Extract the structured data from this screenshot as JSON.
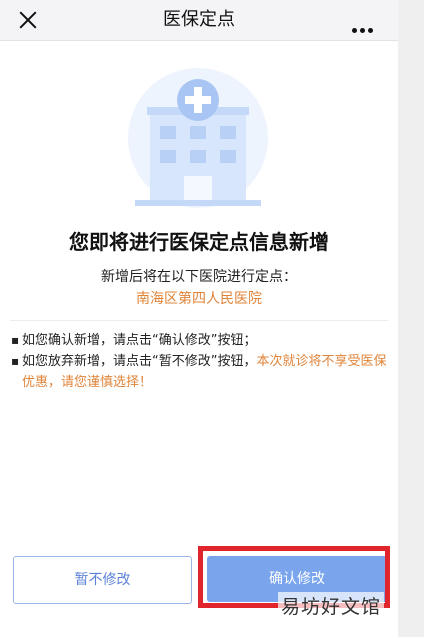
{
  "header": {
    "title": "医保定点",
    "close_icon": "close-icon",
    "more_icon": "more-icon"
  },
  "illustration": {
    "icon": "hospital-icon",
    "colors": {
      "circle": "#eef4fe",
      "building": "#cfe0fb",
      "cross_bg": "#a9c5f3"
    }
  },
  "main": {
    "headline": "您即将进行医保定点信息新增",
    "subtitle": "新增后将在以下医院进行定点：",
    "hospital_name": "南海区第四人民医院"
  },
  "notes": {
    "bullet_char": "▪",
    "item1": "如您确认新增，请点击“确认修改”按钮；",
    "item2_normal": "如您放弃新增，请点击“暂不修改”按钮，",
    "item2_highlight": "本次就诊将不享受医保优惠，请您谨慎选择！"
  },
  "buttons": {
    "cancel_label": "暂不修改",
    "confirm_label": "确认修改"
  },
  "watermark": "易坊好文馆",
  "colors": {
    "accent": "#7aa5ec",
    "warning": "#e0843a",
    "highlight_box": "#e1252c"
  }
}
